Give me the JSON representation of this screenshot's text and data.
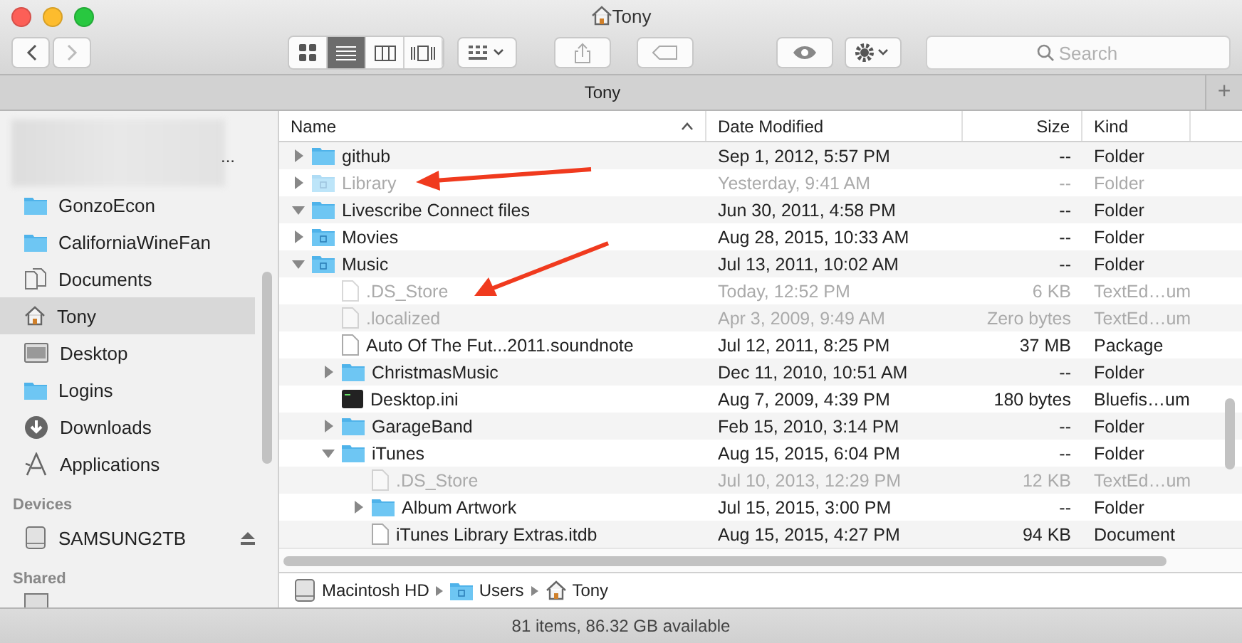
{
  "window": {
    "title": "Tony"
  },
  "toolbar": {
    "view_modes": [
      {
        "selected": false
      },
      {
        "selected": true
      },
      {
        "selected": false
      },
      {
        "selected": false
      }
    ],
    "search": {
      "placeholder": "Search"
    }
  },
  "tab_bar": {
    "title": "Tony",
    "add": "+"
  },
  "sidebar": {
    "blurred_item_ellipsis": "...",
    "favorites": [
      {
        "label": "GonzoEcon",
        "kind": "folder",
        "selected": false
      },
      {
        "label": "CaliforniaWineFan",
        "kind": "folder",
        "selected": false
      },
      {
        "label": "Documents",
        "kind": "documents",
        "selected": false
      },
      {
        "label": "Tony",
        "kind": "home",
        "selected": true
      },
      {
        "label": "Desktop",
        "kind": "desktop",
        "selected": false
      },
      {
        "label": "Logins",
        "kind": "folder",
        "selected": false
      },
      {
        "label": "Downloads",
        "kind": "downloads",
        "selected": false
      },
      {
        "label": "Applications",
        "kind": "applications",
        "selected": false
      }
    ],
    "sections": [
      {
        "title": "Devices",
        "items": [
          {
            "label": "SAMSUNG2TB",
            "kind": "disk",
            "selected": false
          }
        ]
      },
      {
        "title": "Shared"
      }
    ]
  },
  "table": {
    "columns": [
      {
        "label": "Name",
        "sorted": true
      },
      {
        "label": "Date Modified",
        "sorted": false
      },
      {
        "label": "Size",
        "sorted": false
      },
      {
        "label": "Kind",
        "sorted": false
      }
    ],
    "rows": [
      {
        "name": "github",
        "kind": "folder",
        "expanded": false,
        "dimmed": false,
        "date": "Sep 1, 2012, 5:57 PM",
        "size": "--",
        "type": "Folder"
      },
      {
        "name": "Library",
        "kind": "library-folder",
        "expanded": false,
        "dimmed": true,
        "date": "Yesterday, 9:41 AM",
        "size": "--",
        "type": "Folder"
      },
      {
        "name": "Livescribe Connect files",
        "kind": "folder",
        "expanded": true,
        "dimmed": false,
        "date": "Jun 30, 2011, 4:58 PM",
        "size": "--",
        "type": "Folder"
      },
      {
        "name": "Movies",
        "kind": "movies-folder",
        "expanded": false,
        "dimmed": false,
        "date": "Aug 28, 2015, 10:33 AM",
        "size": "--",
        "type": "Folder"
      },
      {
        "name": "Music",
        "kind": "music-folder",
        "expanded": true,
        "dimmed": false,
        "date": "Jul 13, 2011, 10:02 AM",
        "size": "--",
        "type": "Folder",
        "children": [
          {
            "name": ".DS_Store",
            "kind": "document",
            "dimmed": true,
            "date": "Today, 12:52 PM",
            "size": "6 KB",
            "type": "TextEd…um"
          },
          {
            "name": ".localized",
            "kind": "document",
            "dimmed": true,
            "date": "Apr 3, 2009, 9:49 AM",
            "size": "Zero bytes",
            "type": "TextEd…um"
          },
          {
            "name": "Auto Of The Fut...2011.soundnote",
            "kind": "document",
            "dimmed": false,
            "date": "Jul 12, 2011, 8:25 PM",
            "size": "37 MB",
            "type": "Package"
          },
          {
            "name": "ChristmasMusic",
            "kind": "folder",
            "expanded": false,
            "dimmed": false,
            "date": "Dec 11, 2010, 10:51 AM",
            "size": "--",
            "type": "Folder"
          },
          {
            "name": "Desktop.ini",
            "kind": "terminal",
            "dimmed": false,
            "date": "Aug 7, 2009, 4:39 PM",
            "size": "180 bytes",
            "type": "Bluefis…um"
          },
          {
            "name": "GarageBand",
            "kind": "folder",
            "expanded": false,
            "dimmed": false,
            "date": "Feb 15, 2010, 3:14 PM",
            "size": "--",
            "type": "Folder"
          },
          {
            "name": "iTunes",
            "kind": "folder",
            "expanded": true,
            "dimmed": false,
            "date": "Aug 15, 2015, 6:04 PM",
            "size": "--",
            "type": "Folder",
            "children": [
              {
                "name": ".DS_Store",
                "kind": "document",
                "dimmed": true,
                "date": "Jul 10, 2013, 12:29 PM",
                "size": "12 KB",
                "type": "TextEd…um"
              },
              {
                "name": "Album Artwork",
                "kind": "folder",
                "expanded": false,
                "dimmed": false,
                "date": "Jul 15, 2015, 3:00 PM",
                "size": "--",
                "type": "Folder"
              },
              {
                "name": "iTunes Library Extras.itdb",
                "kind": "document",
                "dimmed": false,
                "date": "Aug 15, 2015, 4:27 PM",
                "size": "94 KB",
                "type": "Document"
              }
            ]
          }
        ]
      }
    ]
  },
  "path_bar": [
    {
      "label": "Macintosh HD",
      "kind": "disk"
    },
    {
      "label": "Users",
      "kind": "users-folder"
    },
    {
      "label": "Tony",
      "kind": "home"
    }
  ],
  "status_bar": "81 items, 86.32 GB available"
}
